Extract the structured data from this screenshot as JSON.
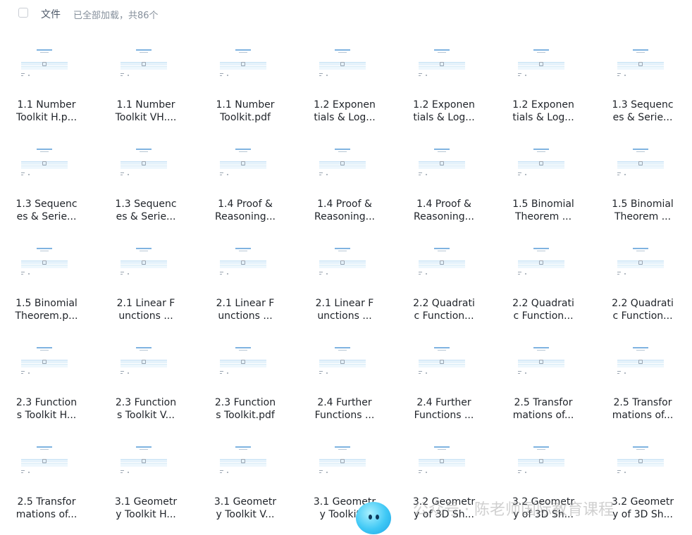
{
  "header": {
    "column_label": "文件",
    "status": "已全部加载，共86个"
  },
  "files": [
    {
      "line1": "1.1 Number",
      "line2": "Toolkit H.p..."
    },
    {
      "line1": "1.1 Number",
      "line2": "Toolkit VH...."
    },
    {
      "line1": "1.1 Number",
      "line2": "Toolkit.pdf"
    },
    {
      "line1": "1.2 Exponen",
      "line2": "tials & Log..."
    },
    {
      "line1": "1.2 Exponen",
      "line2": "tials & Log..."
    },
    {
      "line1": "1.2 Exponen",
      "line2": "tials & Log..."
    },
    {
      "line1": "1.3 Sequenc",
      "line2": "es & Serie..."
    },
    {
      "line1": "1.3 Sequenc",
      "line2": "es & Serie..."
    },
    {
      "line1": "1.3 Sequenc",
      "line2": "es & Serie..."
    },
    {
      "line1": "1.4 Proof &",
      "line2": "Reasoning..."
    },
    {
      "line1": "1.4 Proof &",
      "line2": "Reasoning..."
    },
    {
      "line1": "1.4 Proof &",
      "line2": "Reasoning..."
    },
    {
      "line1": "1.5 Binomial",
      "line2": "Theorem ..."
    },
    {
      "line1": "1.5 Binomial",
      "line2": "Theorem ..."
    },
    {
      "line1": "1.5 Binomial",
      "line2": "Theorem.p..."
    },
    {
      "line1": "2.1 Linear F",
      "line2": "unctions ..."
    },
    {
      "line1": "2.1 Linear F",
      "line2": "unctions ..."
    },
    {
      "line1": "2.1 Linear F",
      "line2": "unctions ..."
    },
    {
      "line1": "2.2 Quadrati",
      "line2": "c Function..."
    },
    {
      "line1": "2.2 Quadrati",
      "line2": "c Function..."
    },
    {
      "line1": "2.2 Quadrati",
      "line2": "c Function..."
    },
    {
      "line1": "2.3 Function",
      "line2": "s Toolkit H..."
    },
    {
      "line1": "2.3 Function",
      "line2": "s Toolkit V..."
    },
    {
      "line1": "2.3 Function",
      "line2": "s Toolkit.pdf"
    },
    {
      "line1": "2.4 Further",
      "line2": "Functions ..."
    },
    {
      "line1": "2.4 Further",
      "line2": "Functions ..."
    },
    {
      "line1": "2.5 Transfor",
      "line2": "mations of..."
    },
    {
      "line1": "2.5 Transfor",
      "line2": "mations of..."
    },
    {
      "line1": "2.5 Transfor",
      "line2": "mations of..."
    },
    {
      "line1": "3.1 Geometr",
      "line2": "y Toolkit H..."
    },
    {
      "line1": "3.1 Geometr",
      "line2": "y Toolkit V..."
    },
    {
      "line1": "3.1 Geometr",
      "line2": "y Toolkit..."
    },
    {
      "line1": "3.2 Geometr",
      "line2": "y of 3D Sh..."
    },
    {
      "line1": "3.2 Geometr",
      "line2": "y of 3D Sh..."
    },
    {
      "line1": "3.2 Geometr",
      "line2": "y of 3D Sh..."
    }
  ],
  "watermark": "公众号 · 陈老师国际教育课程"
}
